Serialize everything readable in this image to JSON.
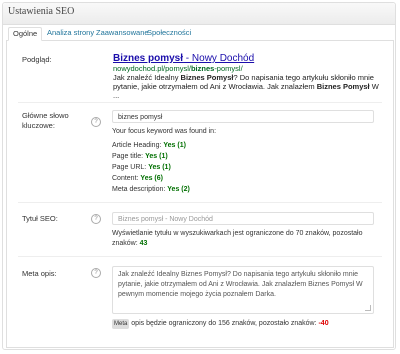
{
  "header": {
    "title": "Ustawienia SEO"
  },
  "tabs": [
    {
      "label": "Ogólne"
    },
    {
      "label": "Analiza strony"
    },
    {
      "label": "Zaawansowane"
    },
    {
      "label": "Społeczności"
    }
  ],
  "preview": {
    "label": "Podgląd:",
    "title_bold": "Biznes pomysł",
    "title_rest": " - Nowy Dochód",
    "url_start": "nowydochod.pl/pomysl/",
    "url_bold": "biznes",
    "url_end": "-pomysl/",
    "desc_1": "Jak znaleźć Idealny ",
    "desc_bold_1": "Biznes Pomysł",
    "desc_2": "? Do napisania tego artykułu skłoniło mnie pytanie, jakie otrzymałem od Ani z Wrocławia. Jak znalazłem ",
    "desc_bold_2": "Biznes Pomysł",
    "desc_3": " W ..."
  },
  "keyword": {
    "label_line1": "Główne słowo",
    "label_line2": "kluczowe:",
    "value": "biznes pomysł",
    "found_text": "Your focus keyword was found in:",
    "results": [
      {
        "label": "Article Heading:",
        "value": "Yes (1)"
      },
      {
        "label": "Page title:",
        "value": "Yes (1)"
      },
      {
        "label": "Page URL:",
        "value": "Yes (1)"
      },
      {
        "label": "Content:",
        "value": "Yes (6)"
      },
      {
        "label": "Meta description:",
        "value": "Yes (2)"
      }
    ]
  },
  "seo_title": {
    "label": "Tytuł SEO:",
    "placeholder": "Biznes pomysł - Nowy Dochód",
    "note_1": "Wyświetlanie tytułu w wyszukiwarkach jest ograniczone do 70 znaków, pozostało",
    "note_2": "znaków: ",
    "remaining": "43"
  },
  "meta": {
    "label": "Meta opis:",
    "text": "Jak znaleźć Idealny Biznes Pomysł? Do napisania tego artykułu skłoniło mnie pytanie, jakie otrzymałem od Ani z Wrocławia. Jak znalazłem Biznes Pomysł W pewnym momencie mojego życia poznałem Darka.",
    "tag": "Meta",
    "note": " opis będzie ograniczony do 156 znaków, pozostało znaków: ",
    "remaining": "-40"
  },
  "help_icon": "?",
  "colors": {
    "link": "#1a0dab",
    "url": "#006621",
    "positive": "#006f00",
    "negative": "#dd0000",
    "tab_link": "#21759b"
  }
}
